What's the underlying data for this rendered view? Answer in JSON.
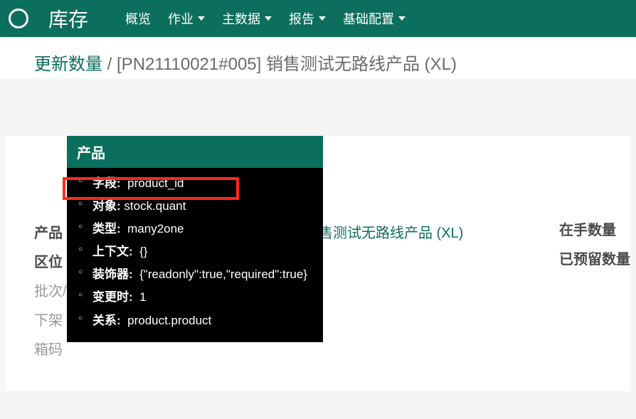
{
  "navbar": {
    "brand": "库存",
    "items": [
      {
        "label": "概览",
        "dropdown": false
      },
      {
        "label": "作业",
        "dropdown": true
      },
      {
        "label": "主数据",
        "dropdown": true
      },
      {
        "label": "报告",
        "dropdown": true
      },
      {
        "label": "基础配置",
        "dropdown": true
      }
    ]
  },
  "breadcrumb": {
    "link": "更新数量",
    "sep": " / ",
    "current": "[PN21110021#005] 销售测试无路线产品 (XL)"
  },
  "form": {
    "product_label": "产品",
    "product_value": "销售测试无路线产品 (XL)",
    "location_label": "区位",
    "lot_label": "批次/",
    "unshelf_label": "下架",
    "box_label": "箱码",
    "onhand_label": "在手数量",
    "reserved_label": "已预留数量"
  },
  "tooltip": {
    "title": "产品",
    "rows": [
      {
        "lbl": "字段:",
        "val": "product_id"
      },
      {
        "lbl": "对象:",
        "val": "stock.quant"
      },
      {
        "lbl": "类型:",
        "val": "many2one"
      },
      {
        "lbl": "上下文:",
        "val": "{}"
      },
      {
        "lbl": "装饰器:",
        "val": "{\"readonly\":true,\"required\":true}"
      },
      {
        "lbl": "变更时:",
        "val": "1"
      },
      {
        "lbl": "关系:",
        "val": "product.product"
      }
    ]
  }
}
